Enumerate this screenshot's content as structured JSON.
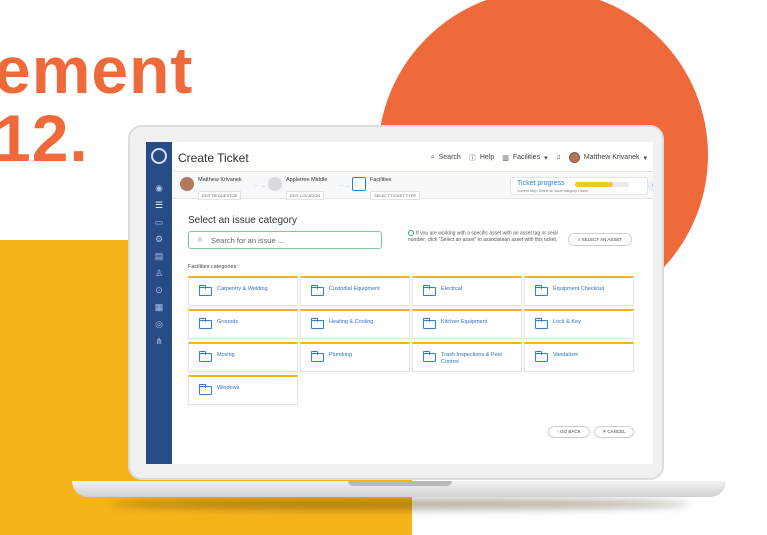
{
  "headline": {
    "line1": "ement",
    "line2": "12."
  },
  "colors": {
    "orange": "#ee6a3a",
    "yellow": "#f6b31b",
    "sidebar": "#274c85",
    "link": "#2d6fc4"
  },
  "sidebar": {
    "icons": [
      "dashboard-icon",
      "list-icon",
      "monitor-icon",
      "gear-icon",
      "calendar-icon",
      "user-icon",
      "location-icon",
      "chart-icon",
      "eye-icon",
      "org-chart-icon"
    ]
  },
  "header": {
    "title": "Create Ticket",
    "search": "Search",
    "help": "Help",
    "facilities": "Facilities",
    "user": "Matthew Krivanek"
  },
  "steps": [
    {
      "title": "Matthew Krivanek",
      "button": "EDIT REQUESTOR"
    },
    {
      "title": "Appletree Middle",
      "button": "EDIT LOCATION"
    },
    {
      "title": "Facilities",
      "button": "SELECT TICKET TYPE"
    }
  ],
  "progress": {
    "label": "Ticket progress",
    "subtitle": "Current Step: Select an issue category / issue",
    "value": 0.7
  },
  "main": {
    "heading": "Select an issue category",
    "search_placeholder": "Search for an issue ...",
    "info_text": "If you are working with a specific asset with an asset tag or seial number, click \"Select an asset\" to associatean asset with this ticket.",
    "select_asset": "SELECT AN ASSET",
    "categories_label": "Facilities categories:",
    "categories": [
      "Carpentry & Welding",
      "Custodial Equipment",
      "Electrcal",
      "Equipment Checkout",
      "Grounds",
      "Heating & Cooling",
      "Kitchen Equipment",
      "Lock & Key",
      "Moving",
      "Plumbing",
      "Trash Inspections & Pest Control",
      "Vandalism",
      "Windows"
    ],
    "go_back": "GO BACK",
    "cancel": "CANCEL"
  }
}
